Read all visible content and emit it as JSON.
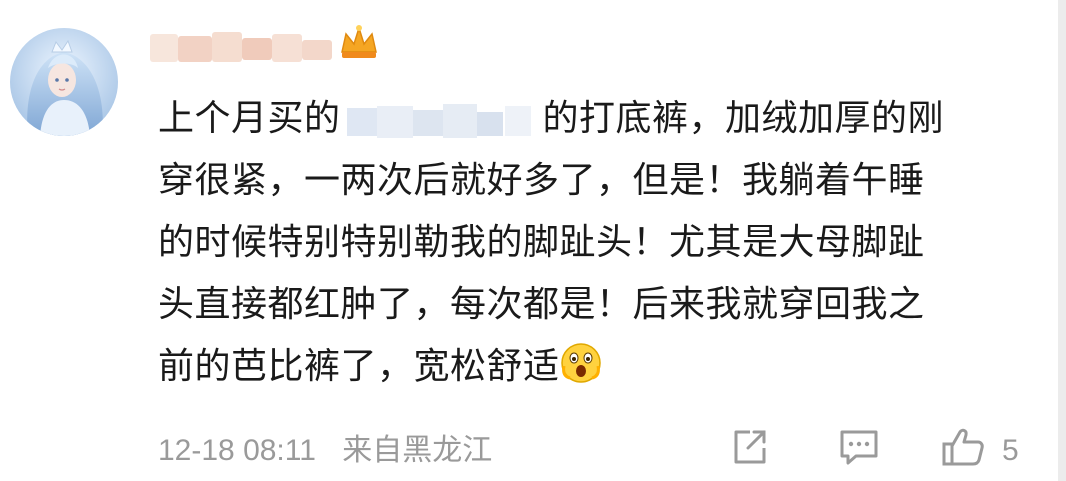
{
  "comment": {
    "lines": [
      {
        "pre": "上个月买的",
        "post": "的打底裤，加绒加厚的刚"
      },
      {
        "text": "穿很紧，一两次后就好多了，但是！我躺着午睡"
      },
      {
        "text": "的时候特别特别勒我的脚趾头！尤其是大母脚趾"
      },
      {
        "text": "头直接都红肿了，每次都是！后来我就穿回我之"
      },
      {
        "text": "前的芭比裤了，宽松舒适"
      }
    ]
  },
  "footer": {
    "timestamp": "12-18 08:11",
    "location": "来自黑龙江",
    "like_count": "5"
  },
  "icons": {
    "share": "share-icon",
    "comment": "comment-icon",
    "like": "thumbs-up-icon",
    "emoji": "surprised-face-emoji",
    "vip": "crown-badge-icon"
  },
  "colors": {
    "text": "#1a1a1a",
    "meta": "#9a9a9a",
    "icon": "#9a9a9a"
  }
}
